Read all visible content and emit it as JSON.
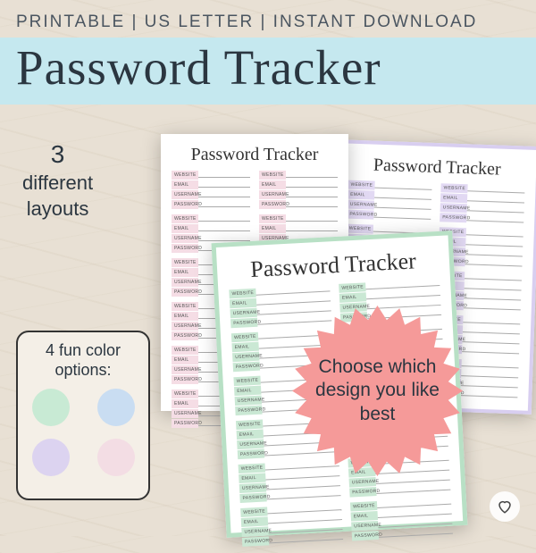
{
  "header": {
    "tags": "PRINTABLE  |  US LETTER  |  INSTANT DOWNLOAD",
    "title": "Password Tracker"
  },
  "layouts_label": {
    "line1": "3",
    "line2": "different",
    "line3": "layouts"
  },
  "color_options": {
    "title": "4 fun color options:",
    "swatches": [
      "#c8ead4",
      "#c9ddf2",
      "#dcd3f0",
      "#f3dde4"
    ]
  },
  "sheet": {
    "title": "Password Tracker",
    "fields": [
      "WEBSITE",
      "EMAIL",
      "USERNAME",
      "PASSWORD"
    ]
  },
  "badge": {
    "text": "Choose which design you like best",
    "color": "#f59a99"
  }
}
